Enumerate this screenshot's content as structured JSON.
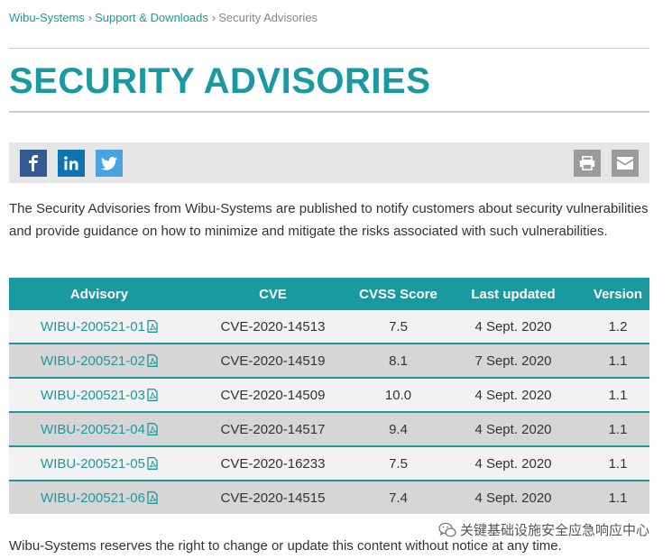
{
  "breadcrumb": {
    "home": "Wibu-Systems",
    "section": "Support & Downloads",
    "current": "Security Advisories",
    "separator": "›"
  },
  "page": {
    "title": "SECURITY ADVISORIES",
    "intro": "The Security Advisories from Wibu-Systems are published to notify customers about security vulnerabilities and provide guidance on how to minimize and mitigate the risks associated with such vulnerabilities.",
    "footer": "Wibu-Systems reserves the right to change or update this content without notice at any time."
  },
  "share": {
    "icons": [
      "facebook-icon",
      "linkedin-icon",
      "twitter-icon",
      "print-icon",
      "email-icon"
    ]
  },
  "table": {
    "headers": [
      "Advisory",
      "CVE",
      "CVSS Score",
      "Last updated",
      "Version"
    ],
    "rows": [
      {
        "advisory": "WIBU-200521-01",
        "cve": "CVE-2020-14513",
        "score": "7.5",
        "updated": "4 Sept. 2020",
        "version": "1.2"
      },
      {
        "advisory": "WIBU-200521-02",
        "cve": "CVE-2020-14519",
        "score": "8.1",
        "updated": "7 Sept. 2020",
        "version": "1.1"
      },
      {
        "advisory": "WIBU-200521-03",
        "cve": "CVE-2020-14509",
        "score": "10.0",
        "updated": "4 Sept. 2020",
        "version": "1.1"
      },
      {
        "advisory": "WIBU-200521-04",
        "cve": "CVE-2020-14517",
        "score": "9.4",
        "updated": "4 Sept. 2020",
        "version": "1.1"
      },
      {
        "advisory": "WIBU-200521-05",
        "cve": "CVE-2020-16233",
        "score": "7.5",
        "updated": "4 Sept. 2020",
        "version": "1.1"
      },
      {
        "advisory": "WIBU-200521-06",
        "cve": "CVE-2020-14515",
        "score": "7.4",
        "updated": "4 Sept. 2020",
        "version": "1.1"
      }
    ]
  },
  "watermark": {
    "text": "关键基础设施安全应急响应中心"
  },
  "colors": {
    "accent": "#1a9aa0",
    "facebook": "#355a93",
    "linkedin": "#0e73b0",
    "twitter": "#4aa3df",
    "utility": "#9b9b9b"
  }
}
